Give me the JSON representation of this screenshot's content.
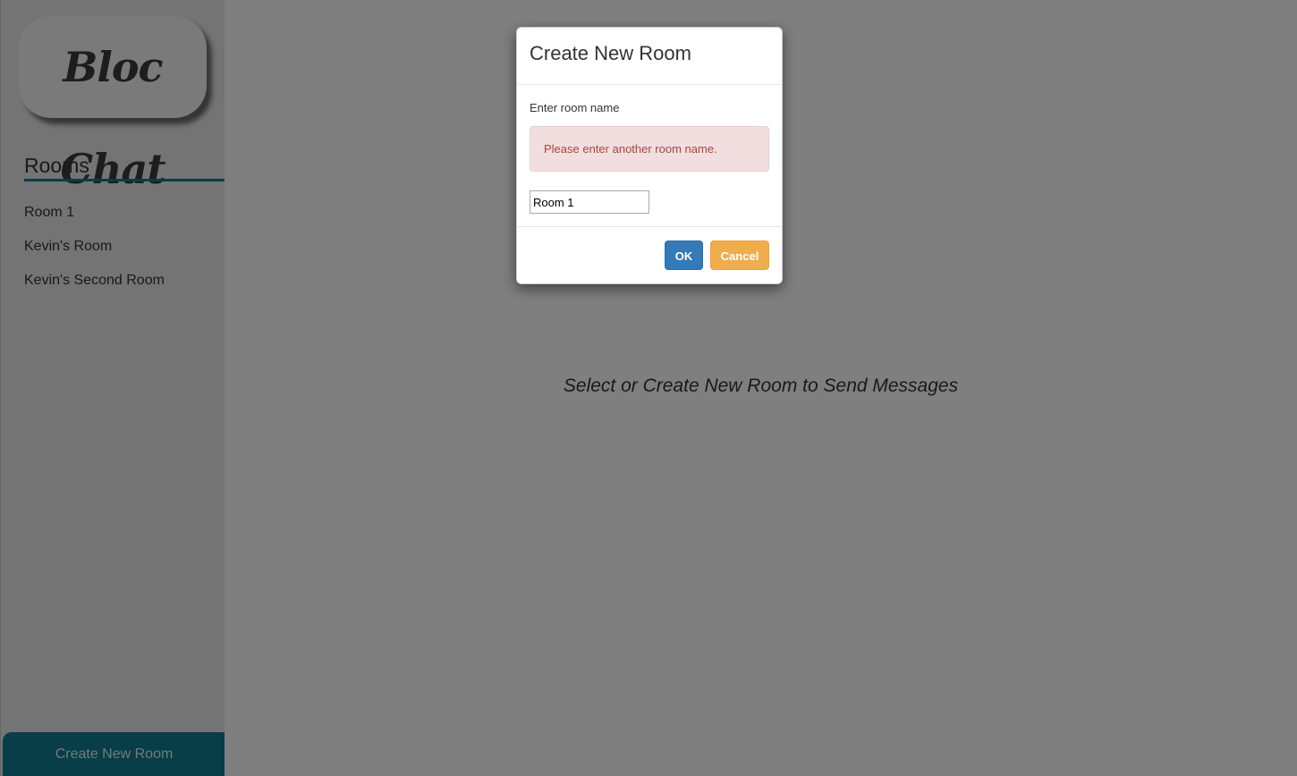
{
  "sidebar": {
    "logo_text": "Bloc Chat",
    "rooms_heading": "Rooms",
    "rooms": [
      {
        "label": "Room 1"
      },
      {
        "label": "Kevin's Room"
      },
      {
        "label": "Kevin's Second Room"
      }
    ],
    "create_button_label": "Create New Room"
  },
  "main": {
    "placeholder_message": "Select or Create New Room to Send Messages"
  },
  "modal": {
    "title": "Create New Room",
    "field_label": "Enter room name",
    "error_message": "Please enter another room name.",
    "input_value": "Room 1",
    "ok_label": "OK",
    "cancel_label": "Cancel"
  },
  "colors": {
    "accent": "#0f7d8f",
    "ok_button": "#337ab7",
    "cancel_button": "#f0ad4e",
    "error_bg": "#f2dede",
    "error_text": "#a94442"
  }
}
